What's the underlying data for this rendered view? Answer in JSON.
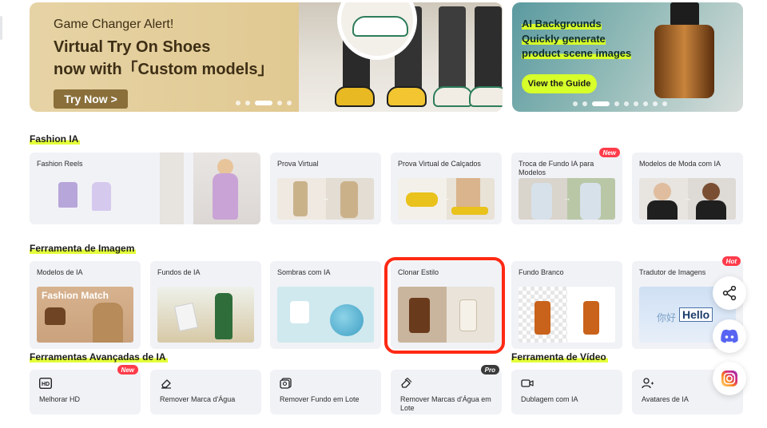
{
  "banner_left": {
    "tag": "Game Changer Alert!",
    "title_line1": "Virtual Try On Shoes",
    "title_line2": "now with「Custom models」",
    "button": "Try Now >"
  },
  "banner_right": {
    "tag": "AI Backgrounds",
    "line1": "Quickly generate",
    "line2": "product scene images",
    "button": "View the Guide"
  },
  "sections": {
    "fashion": {
      "title": "Fashion IA",
      "cards": [
        {
          "label": "Fashion Reels",
          "badge": ""
        },
        {
          "label": "Prova Virtual",
          "badge": ""
        },
        {
          "label": "Prova Virtual de Calçados",
          "badge": ""
        },
        {
          "label": "Troca de Fundo IA para Modelos",
          "badge": "New"
        },
        {
          "label": "Modelos de Moda com IA",
          "badge": ""
        }
      ]
    },
    "image_tools": {
      "title": "Ferramenta de Imagem",
      "cards": [
        {
          "label": "Modelos de IA",
          "badge": "",
          "image_text": "Fashion Match"
        },
        {
          "label": "Fundos de IA",
          "badge": ""
        },
        {
          "label": "Sombras com IA",
          "badge": ""
        },
        {
          "label": "Clonar Estilo",
          "badge": ""
        },
        {
          "label": "Fundo Branco",
          "badge": ""
        },
        {
          "label": "Tradutor de Imagens",
          "badge": "Hot",
          "image_text_a": "你好",
          "image_text_b": "Hello"
        }
      ]
    },
    "advanced": {
      "title": "Ferramentas Avançadas de IA",
      "tools": [
        {
          "label": "Melhorar HD",
          "badge": "New",
          "icon": "hd-icon"
        },
        {
          "label": "Remover Marca d'Água",
          "badge": "",
          "icon": "eraser-icon"
        },
        {
          "label": "Remover Fundo em Lote",
          "badge": "",
          "icon": "batch-bg-icon"
        },
        {
          "label": "Remover Marcas d'Água em Lote",
          "badge": "Pro",
          "icon": "batch-eraser-icon"
        }
      ]
    },
    "video": {
      "title": "Ferramenta de Vídeo",
      "tools": [
        {
          "label": "Dublagem com IA",
          "icon": "video-camera-icon"
        },
        {
          "label": "Avatares de IA",
          "icon": "avatar-icon"
        }
      ]
    }
  },
  "floating": [
    "share-icon",
    "discord-icon",
    "instagram-icon"
  ],
  "colors": {
    "accent_highlight": "#e4ff3a",
    "badge_red": "#ff3b4a",
    "selection_red": "#ff2a14",
    "card_bg": "#f1f2f6"
  }
}
